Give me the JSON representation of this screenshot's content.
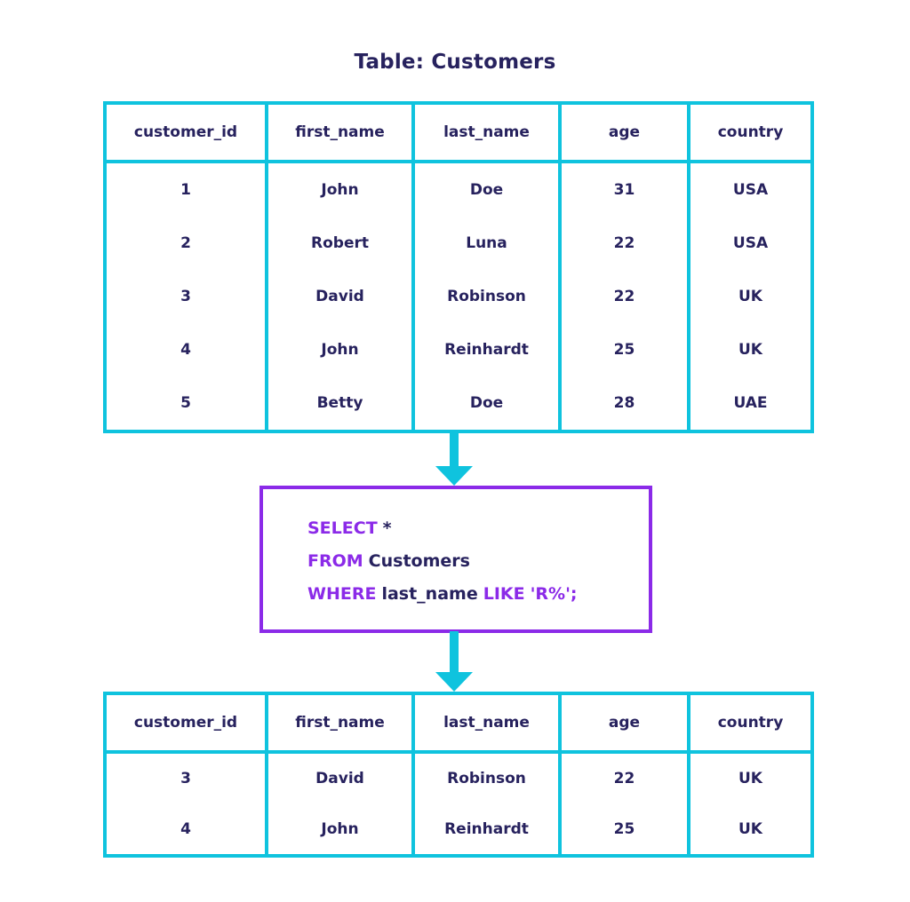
{
  "title": "Table: Customers",
  "colors": {
    "table_border": "#0FC3DE",
    "arrow": "#0FC3DE",
    "query_border": "#8B2AE8",
    "keyword": "#8B2AE8",
    "identifier": "#27225E",
    "text": "#27225E",
    "background": "#FFFFFF"
  },
  "source_table": {
    "name": "Customers",
    "columns": [
      "customer_id",
      "first_name",
      "last_name",
      "age",
      "country"
    ],
    "rows": [
      [
        "1",
        "John",
        "Doe",
        "31",
        "USA"
      ],
      [
        "2",
        "Robert",
        "Luna",
        "22",
        "USA"
      ],
      [
        "3",
        "David",
        "Robinson",
        "22",
        "UK"
      ],
      [
        "4",
        "John",
        "Reinhardt",
        "25",
        "UK"
      ],
      [
        "5",
        "Betty",
        "Doe",
        "28",
        "UAE"
      ]
    ]
  },
  "query": {
    "full_text": "SELECT * FROM Customers WHERE last_name LIKE 'R%';",
    "lines": [
      {
        "tokens": [
          {
            "text": "SELECT",
            "type": "keyword"
          },
          {
            "text": "*",
            "type": "identifier"
          }
        ]
      },
      {
        "tokens": [
          {
            "text": "FROM",
            "type": "keyword"
          },
          {
            "text": "Customers",
            "type": "identifier"
          }
        ]
      },
      {
        "tokens": [
          {
            "text": "WHERE",
            "type": "keyword"
          },
          {
            "text": "last_name",
            "type": "identifier"
          },
          {
            "text": "LIKE",
            "type": "keyword"
          },
          {
            "text": "'R%';",
            "type": "literal"
          }
        ]
      }
    ]
  },
  "result_table": {
    "columns": [
      "customer_id",
      "first_name",
      "last_name",
      "age",
      "country"
    ],
    "rows": [
      [
        "3",
        "David",
        "Robinson",
        "22",
        "UK"
      ],
      [
        "4",
        "John",
        "Reinhardt",
        "25",
        "UK"
      ]
    ]
  },
  "arrows": [
    {
      "name": "arrow-table-to-query",
      "direction": "down"
    },
    {
      "name": "arrow-query-to-result",
      "direction": "down"
    }
  ]
}
